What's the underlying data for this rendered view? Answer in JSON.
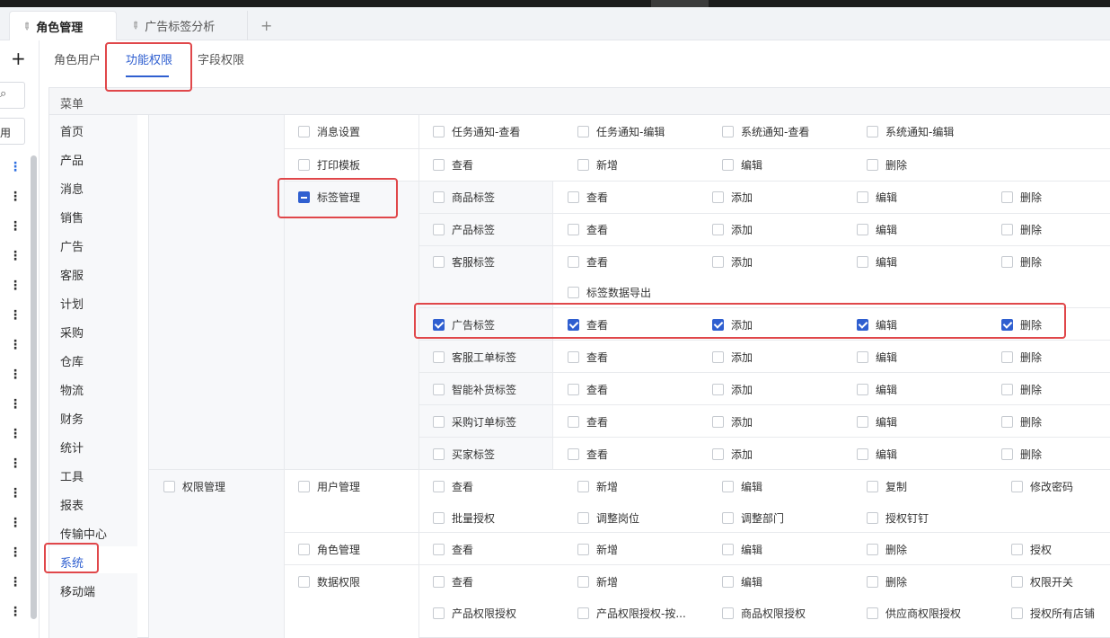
{
  "tabs": [
    {
      "label": "角色管理"
    },
    {
      "label": "广告标签分析"
    }
  ],
  "tab_add_label": "+",
  "sidebar": {
    "add_label": "+",
    "search_glyph": "⌕",
    "status_label": "用",
    "more_glyph": "⋮"
  },
  "subtabs": [
    {
      "label": "角色用户"
    },
    {
      "label": "功能权限"
    },
    {
      "label": "字段权限"
    }
  ],
  "menu": {
    "header": "菜单",
    "items": [
      "首页",
      "产品",
      "消息",
      "销售",
      "广告",
      "客服",
      "计划",
      "采购",
      "仓库",
      "物流",
      "财务",
      "统计",
      "工具",
      "报表",
      "传输中心",
      "系统",
      "移动端"
    ]
  },
  "permissions": {
    "msg_settings": {
      "label": "消息设置",
      "actions": [
        "任务通知-查看",
        "任务通知-编辑",
        "系统通知-查看",
        "系统通知-编辑"
      ]
    },
    "print_template": {
      "label": "打印模板",
      "actions": [
        "查看",
        "新增",
        "编辑",
        "删除"
      ]
    },
    "tag_management": {
      "label": "标签管理",
      "rows": [
        {
          "label": "商品标签",
          "actions": [
            "查看",
            "添加",
            "编辑",
            "删除"
          ]
        },
        {
          "label": "产品标签",
          "actions": [
            "查看",
            "添加",
            "编辑",
            "删除"
          ]
        },
        {
          "label": "客服标签",
          "actions": [
            "查看",
            "添加",
            "编辑",
            "删除"
          ],
          "extra": "标签数据导出"
        },
        {
          "label": "广告标签",
          "actions": [
            "查看",
            "添加",
            "编辑",
            "删除"
          ]
        },
        {
          "label": "客服工单标签",
          "actions": [
            "查看",
            "添加",
            "编辑",
            "删除"
          ]
        },
        {
          "label": "智能补货标签",
          "actions": [
            "查看",
            "添加",
            "编辑",
            "删除"
          ]
        },
        {
          "label": "采购订单标签",
          "actions": [
            "查看",
            "添加",
            "编辑",
            "删除"
          ]
        },
        {
          "label": "买家标签",
          "actions": [
            "查看",
            "添加",
            "编辑",
            "删除"
          ]
        }
      ]
    },
    "auth_management": {
      "label": "权限管理",
      "user_management": {
        "label": "用户管理",
        "actions": [
          "查看",
          "新增",
          "编辑",
          "复制",
          "修改密码",
          "批量授权",
          "调整岗位",
          "调整部门",
          "授权钉钉"
        ]
      },
      "role_management": {
        "label": "角色管理",
        "actions": [
          "查看",
          "新增",
          "编辑",
          "删除",
          "授权"
        ]
      },
      "data_permission": {
        "label": "数据权限",
        "actions": [
          "查看",
          "新增",
          "编辑",
          "删除",
          "权限开关",
          "产品权限授权",
          "产品权限授权-按...",
          "商品权限授权",
          "供应商权限授权",
          "授权所有店铺"
        ]
      }
    }
  }
}
